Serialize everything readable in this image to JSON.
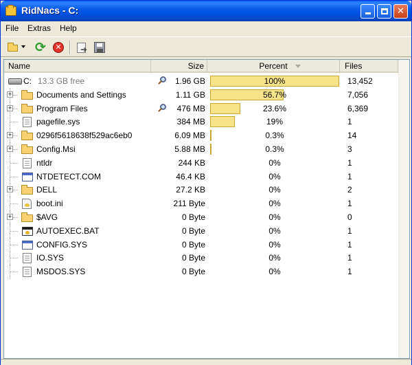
{
  "window": {
    "title": "RidNacs - C:"
  },
  "menu": [
    "File",
    "Extras",
    "Help"
  ],
  "toolbar": {
    "icons": [
      "open-folder-icon",
      "dropdown-arrow-icon",
      "refresh-icon",
      "stop-icon",
      "export-icon",
      "save-icon"
    ]
  },
  "columns": {
    "name": "Name",
    "size": "Size",
    "percent": "Percent",
    "files": "Files"
  },
  "colors": {
    "bar_fill": "#f7e38a",
    "bar_border": "#c9a830",
    "title_bar": "#0054e3"
  },
  "rows": [
    {
      "name": "C:",
      "free": "13.3 GB free",
      "size": "1.96 GB",
      "percent": "100%",
      "percent_value": 100,
      "files": "13,452",
      "type": "drive",
      "expander": false,
      "search": true
    },
    {
      "name": "Documents and Settings",
      "size": "1.11 GB",
      "percent": "56.7%",
      "percent_value": 56.7,
      "files": "7,056",
      "type": "folder",
      "expander": true,
      "search": false
    },
    {
      "name": "Program Files",
      "size": "476 MB",
      "percent": "23.6%",
      "percent_value": 23.6,
      "files": "6,369",
      "type": "folder",
      "expander": true,
      "search": true
    },
    {
      "name": "pagefile.sys",
      "size": "384 MB",
      "percent": "19%",
      "percent_value": 19,
      "files": "1",
      "type": "file",
      "expander": false,
      "search": false
    },
    {
      "name": "0296f5618638f529ac6eb0",
      "size": "6.09 MB",
      "percent": "0.3%",
      "percent_value": 0.3,
      "files": "14",
      "type": "folder",
      "expander": true,
      "search": false
    },
    {
      "name": "Config.Msi",
      "size": "5.88 MB",
      "percent": "0.3%",
      "percent_value": 0.3,
      "files": "3",
      "type": "folder",
      "expander": true,
      "search": false
    },
    {
      "name": "ntldr",
      "size": "244 KB",
      "percent": "0%",
      "percent_value": 0,
      "files": "1",
      "type": "file",
      "expander": false,
      "search": false
    },
    {
      "name": "NTDETECT.COM",
      "size": "46.4 KB",
      "percent": "0%",
      "percent_value": 0,
      "files": "1",
      "type": "sysfile",
      "expander": false,
      "search": false
    },
    {
      "name": "DELL",
      "size": "27.2 KB",
      "percent": "0%",
      "percent_value": 0,
      "files": "2",
      "type": "folder",
      "expander": true,
      "search": false
    },
    {
      "name": "boot.ini",
      "size": "211 Byte",
      "percent": "0%",
      "percent_value": 0,
      "files": "1",
      "type": "inifile",
      "expander": false,
      "search": false
    },
    {
      "name": "$AVG",
      "size": "0 Byte",
      "percent": "0%",
      "percent_value": 0,
      "files": "0",
      "type": "folder",
      "expander": true,
      "search": false
    },
    {
      "name": "AUTOEXEC.BAT",
      "size": "0 Byte",
      "percent": "0%",
      "percent_value": 0,
      "files": "1",
      "type": "batfile",
      "expander": false,
      "search": false
    },
    {
      "name": "CONFIG.SYS",
      "size": "0 Byte",
      "percent": "0%",
      "percent_value": 0,
      "files": "1",
      "type": "sysfile",
      "expander": false,
      "search": false
    },
    {
      "name": "IO.SYS",
      "size": "0 Byte",
      "percent": "0%",
      "percent_value": 0,
      "files": "1",
      "type": "file",
      "expander": false,
      "search": false
    },
    {
      "name": "MSDOS.SYS",
      "size": "0 Byte",
      "percent": "0%",
      "percent_value": 0,
      "files": "1",
      "type": "file",
      "expander": false,
      "search": false
    }
  ]
}
